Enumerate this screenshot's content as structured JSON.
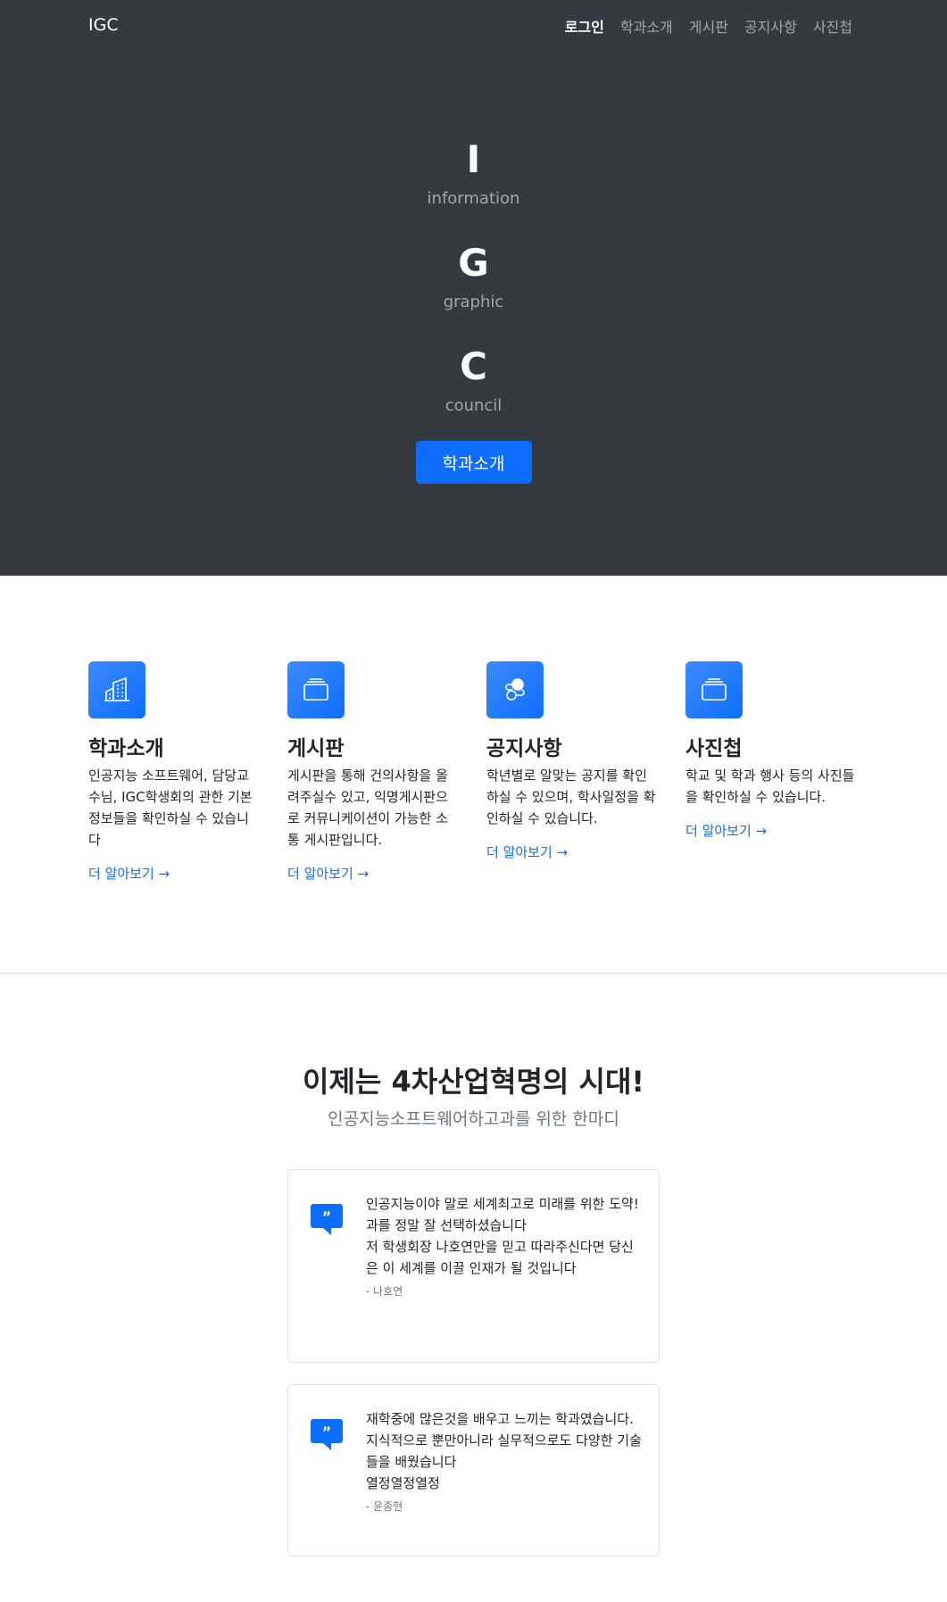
{
  "nav": {
    "brand": "IGC",
    "items": [
      {
        "label": "로그인",
        "active": true
      },
      {
        "label": "학과소개"
      },
      {
        "label": "게시판"
      },
      {
        "label": "공지사항"
      },
      {
        "label": "사진첩"
      }
    ]
  },
  "hero": {
    "letters": [
      {
        "letter": "I",
        "word": "information"
      },
      {
        "letter": "G",
        "word": "graphic"
      },
      {
        "letter": "C",
        "word": "council"
      }
    ],
    "button_label": "학과소개"
  },
  "features": [
    {
      "icon": "building-icon",
      "title": "학과소개",
      "desc": "인공지능 소프트웨어, 담당교수님, IGC학생회의 관한 기본 정보들을 확인하실 수 있습니다",
      "link": "더 알아보기 →"
    },
    {
      "icon": "folder-icon",
      "title": "게시판",
      "desc": "게시판을 통해 건의사항을 올려주실수 있고, 익명게시판으로 커뮤니케이션이 가능한 소통 게시판입니다.",
      "link": "더 알아보기 →"
    },
    {
      "icon": "toggles-icon",
      "title": "공지사항",
      "desc": "학년별로 알맞는 공지를 확인하실 수 있으며, 학사일정을 확인하실 수 있습니다.",
      "link": "더 알아보기 →"
    },
    {
      "icon": "folder-icon",
      "title": "사진첩",
      "desc": "학교 및 학과 행사 등의 사진들을 확인하실 수 있습니다.",
      "link": "더 알아보기 →"
    }
  ],
  "testimonials": {
    "title": "이제는 4차산업혁명의 시대!",
    "subtitle": "인공지능소프트웨어하고과를 위한 한마디",
    "items": [
      {
        "text": "인공지능이야 말로 세계최고로 미래를 위한 도약!\n과를 정말 잘 선택하셨습니다\n저 학생회장 나호연만을 믿고 따라주신다면 당신은 이 세계를 이끌 인재가 될 것입니다",
        "author": "- 나호연"
      },
      {
        "text": "재학중에 많은것을 배우고 느끼는 학과였습니다.\n지식적으로 뿐만아니라 실무적으로도 다양한 기술들을 배웠습니다\n열정열정열정",
        "author": "- 윤종현"
      }
    ]
  },
  "colors": {
    "primary": "#0d6efd",
    "dark": "#343a40"
  }
}
